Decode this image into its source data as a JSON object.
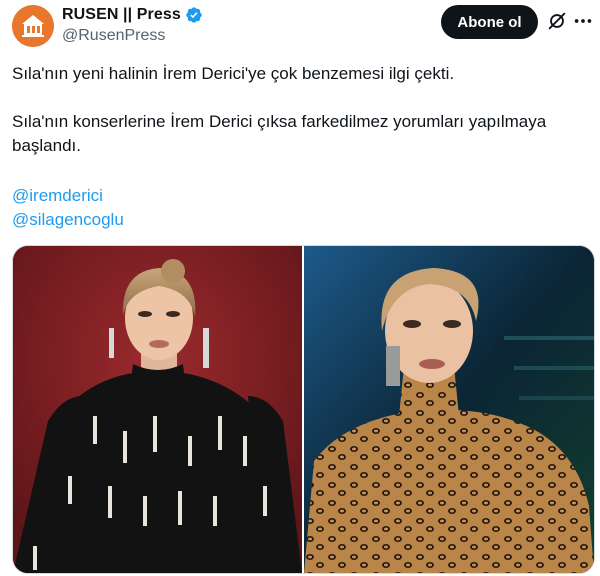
{
  "author": {
    "display_name": "RUSEN || Press",
    "handle": "@RusenPress",
    "verified": true
  },
  "actions": {
    "follow_label": "Abone ol",
    "grok_icon": "grok-slash-circle-icon",
    "more_icon": "more-horizontal-icon"
  },
  "tweet": {
    "paragraphs": [
      "Sıla'nın yeni halinin İrem Derici'ye çok benzemesi ilgi çekti.",
      "Sıla'nın konserlerine İrem Derici çıksa farkedilmez yorumları yapılmaya başlandı."
    ],
    "mentions": [
      "@iremderici",
      "@silagencoglu"
    ]
  },
  "media": {
    "count": 2
  },
  "colors": {
    "accent": "#1d9bf0",
    "button_bg": "#0f1419",
    "text": "#0f1419",
    "secondary_text": "#536471",
    "avatar_bg": "#e8772e"
  }
}
